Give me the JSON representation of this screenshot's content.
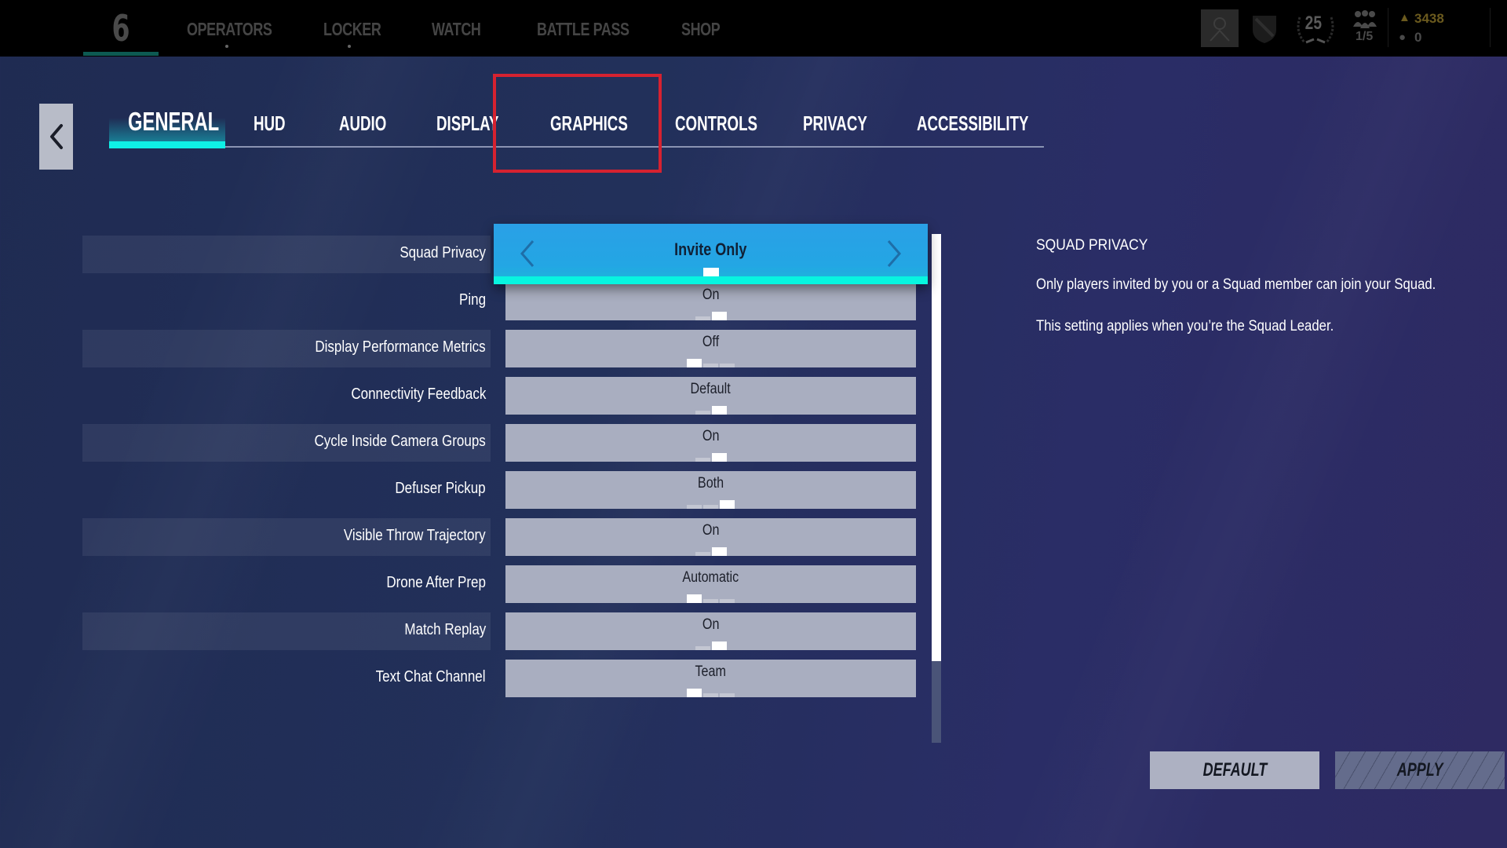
{
  "topbar": {
    "logo": "6",
    "nav": [
      {
        "label": "OPERATORS",
        "has_dot": true
      },
      {
        "label": "LOCKER",
        "has_dot": true
      },
      {
        "label": "WATCH",
        "has_dot": false
      },
      {
        "label": "BATTLE PASS",
        "has_dot": false
      },
      {
        "label": "SHOP",
        "has_dot": false
      }
    ],
    "player_level": "25",
    "squad_count": "1/5",
    "currency_renown": "3438",
    "currency_credits": "0",
    "icons": [
      "avatar-icon",
      "rank-shield-icon",
      "level-laurel-icon",
      "squad-icon",
      "renown-icon",
      "credits-icon"
    ]
  },
  "tabs": {
    "items": [
      "GENERAL",
      "HUD",
      "AUDIO",
      "DISPLAY",
      "GRAPHICS",
      "CONTROLS",
      "PRIVACY",
      "ACCESSIBILITY"
    ],
    "active": "GENERAL",
    "highlighted": "GRAPHICS"
  },
  "settings": [
    {
      "label": "Squad Privacy",
      "value": "Invite Only",
      "options": 1,
      "selected_index": 0,
      "focused": true
    },
    {
      "label": "Ping",
      "value": "On",
      "options": 2,
      "selected_index": 1
    },
    {
      "label": "Display Performance Metrics",
      "value": "Off",
      "options": 3,
      "selected_index": 0
    },
    {
      "label": "Connectivity Feedback",
      "value": "Default",
      "options": 2,
      "selected_index": 1
    },
    {
      "label": "Cycle Inside Camera Groups",
      "value": "On",
      "options": 2,
      "selected_index": 1
    },
    {
      "label": "Defuser Pickup",
      "value": "Both",
      "options": 3,
      "selected_index": 2
    },
    {
      "label": "Visible Throw Trajectory",
      "value": "On",
      "options": 2,
      "selected_index": 1
    },
    {
      "label": "Drone After Prep",
      "value": "Automatic",
      "options": 3,
      "selected_index": 0
    },
    {
      "label": "Match Replay",
      "value": "On",
      "options": 2,
      "selected_index": 1
    },
    {
      "label": "Text Chat Channel",
      "value": "Team",
      "options": 3,
      "selected_index": 0
    }
  ],
  "scroll": {
    "visible_fraction": 0.84,
    "position": 0
  },
  "description": {
    "title": "SQUAD PRIVACY",
    "lines": [
      "Only players invited by you or a Squad member can join your Squad.",
      "This setting applies when you’re the Squad Leader."
    ]
  },
  "buttons": {
    "default": "DEFAULT",
    "apply": "APPLY"
  },
  "colors": {
    "accent_cyan": "#08f5e0",
    "focus_blue": "#2aa0e6",
    "highlight_red": "#d62230",
    "value_bg": "#a9aec0"
  }
}
